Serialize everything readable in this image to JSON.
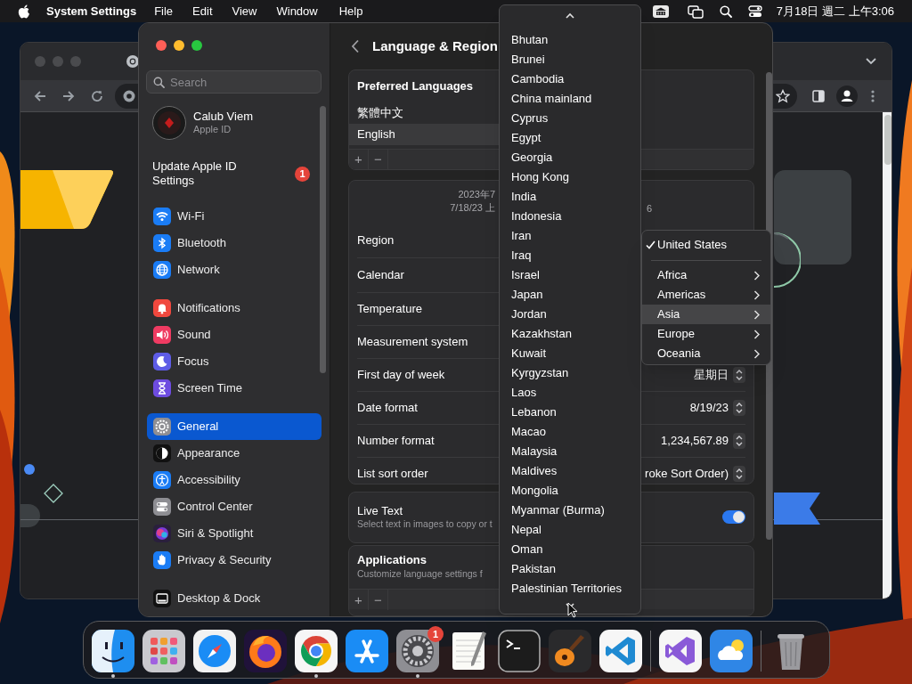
{
  "menu_bar": {
    "app_name": "System Settings",
    "menus": [
      "File",
      "Edit",
      "View",
      "Window",
      "Help"
    ],
    "clock": "7月18日 週二 上午3:06"
  },
  "settings": {
    "sidebar": {
      "search_placeholder": "Search",
      "account": {
        "name": "Calub Viem",
        "subtitle": "Apple ID"
      },
      "notice": {
        "text": "Update Apple ID Settings",
        "badge": "1"
      },
      "groups": [
        [
          {
            "label": "Wi-Fi",
            "kind": "wifi",
            "selected": false
          },
          {
            "label": "Bluetooth",
            "kind": "bluetooth",
            "selected": false
          },
          {
            "label": "Network",
            "kind": "network",
            "selected": false
          }
        ],
        [
          {
            "label": "Notifications",
            "kind": "notifications",
            "selected": false
          },
          {
            "label": "Sound",
            "kind": "sound",
            "selected": false
          },
          {
            "label": "Focus",
            "kind": "focus",
            "selected": false
          },
          {
            "label": "Screen Time",
            "kind": "screen_time",
            "selected": false
          }
        ],
        [
          {
            "label": "General",
            "kind": "general",
            "selected": true
          },
          {
            "label": "Appearance",
            "kind": "appearance",
            "selected": false
          },
          {
            "label": "Accessibility",
            "kind": "accessibility",
            "selected": false
          },
          {
            "label": "Control Center",
            "kind": "control_center",
            "selected": false
          },
          {
            "label": "Siri & Spotlight",
            "kind": "siri",
            "selected": false
          },
          {
            "label": "Privacy & Security",
            "kind": "privacy",
            "selected": false
          }
        ],
        [
          {
            "label": "Desktop & Dock",
            "kind": "dock",
            "selected": false
          }
        ]
      ]
    },
    "title": "Language & Region",
    "preferred_languages": {
      "title": "Preferred Languages",
      "languages": [
        {
          "label": "繁體中文",
          "selected": false
        },
        {
          "label": "English",
          "selected": true
        }
      ],
      "buttons": [
        "+",
        "−"
      ]
    },
    "date_preview": {
      "line_1": "2023年7",
      "line_2": "7/18/23 上",
      "line_2_tail": "6"
    },
    "format_rows": [
      {
        "label": "Region"
      },
      {
        "label": "Calendar"
      },
      {
        "label": "Temperature"
      },
      {
        "label": "Measurement system"
      },
      {
        "label": "First day of week",
        "value": "星期日"
      },
      {
        "label": "Date format",
        "value": "8/19/23"
      },
      {
        "label": "Number format",
        "value": "1,234,567.89"
      },
      {
        "label": "List sort order",
        "value": "roke Sort Order)"
      }
    ],
    "live_text": {
      "title": "Live Text",
      "subtitle": "Select text in images to copy or t",
      "on": true
    },
    "applications": {
      "title": "Applications",
      "subtitle": "Customize language settings f",
      "buttons": [
        "+",
        "−"
      ]
    }
  },
  "region_popup": {
    "countries": [
      "Bhutan",
      "Brunei",
      "Cambodia",
      "China mainland",
      "Cyprus",
      "Egypt",
      "Georgia",
      "Hong Kong",
      "India",
      "Indonesia",
      "Iran",
      "Iraq",
      "Israel",
      "Japan",
      "Jordan",
      "Kazakhstan",
      "Kuwait",
      "Kyrgyzstan",
      "Laos",
      "Lebanon",
      "Macao",
      "Malaysia",
      "Maldives",
      "Mongolia",
      "Myanmar (Burma)",
      "Nepal",
      "Oman",
      "Pakistan",
      "Palestinian Territories"
    ]
  },
  "region_submenu": {
    "current": {
      "label": "United States",
      "checked": true
    },
    "continents": [
      {
        "label": "Africa",
        "selected": false
      },
      {
        "label": "Americas",
        "selected": false
      },
      {
        "label": "Asia",
        "selected": true
      },
      {
        "label": "Europe",
        "selected": false
      },
      {
        "label": "Oceania",
        "selected": false
      }
    ]
  },
  "dock": {
    "apps": [
      {
        "kind": "finder",
        "running": true
      },
      {
        "kind": "launchpad",
        "running": false
      },
      {
        "kind": "safari",
        "running": false
      },
      {
        "kind": "firefox",
        "running": false
      },
      {
        "kind": "chrome",
        "running": true
      },
      {
        "kind": "app_store",
        "running": false
      },
      {
        "kind": "settings",
        "running": true,
        "badge": "1"
      },
      {
        "kind": "textedit",
        "running": false
      },
      {
        "kind": "terminal",
        "running": false
      },
      {
        "kind": "garageband",
        "running": false
      },
      {
        "kind": "vscode",
        "running": false
      },
      {
        "kind": "separator"
      },
      {
        "kind": "visual_studio",
        "running": false
      },
      {
        "kind": "weather",
        "running": false
      },
      {
        "kind": "separator"
      },
      {
        "kind": "trash",
        "running": false
      }
    ]
  }
}
